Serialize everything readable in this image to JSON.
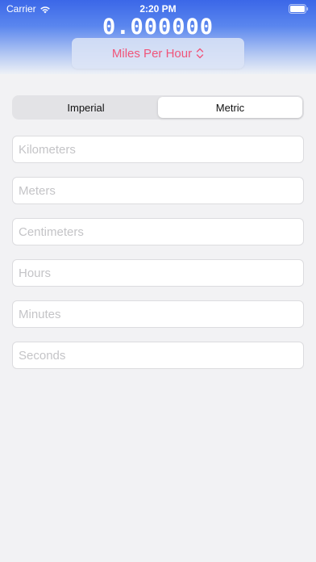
{
  "status_bar": {
    "carrier": "Carrier",
    "time": "2:20 PM"
  },
  "display": {
    "value": "0.000000"
  },
  "unit_selector": {
    "label": "Miles Per Hour",
    "icon": "chevron-up-down-icon"
  },
  "segments": [
    {
      "label": "Imperial",
      "selected": false
    },
    {
      "label": "Metric",
      "selected": true
    }
  ],
  "fields": [
    {
      "placeholder": "Kilometers",
      "value": ""
    },
    {
      "placeholder": "Meters",
      "value": ""
    },
    {
      "placeholder": "Centimeters",
      "value": ""
    },
    {
      "placeholder": "Hours",
      "value": ""
    },
    {
      "placeholder": "Minutes",
      "value": ""
    },
    {
      "placeholder": "Seconds",
      "value": ""
    }
  ],
  "colors": {
    "accent": "#f0557a",
    "header_top": "#3b67e8",
    "background": "#f2f2f4"
  }
}
